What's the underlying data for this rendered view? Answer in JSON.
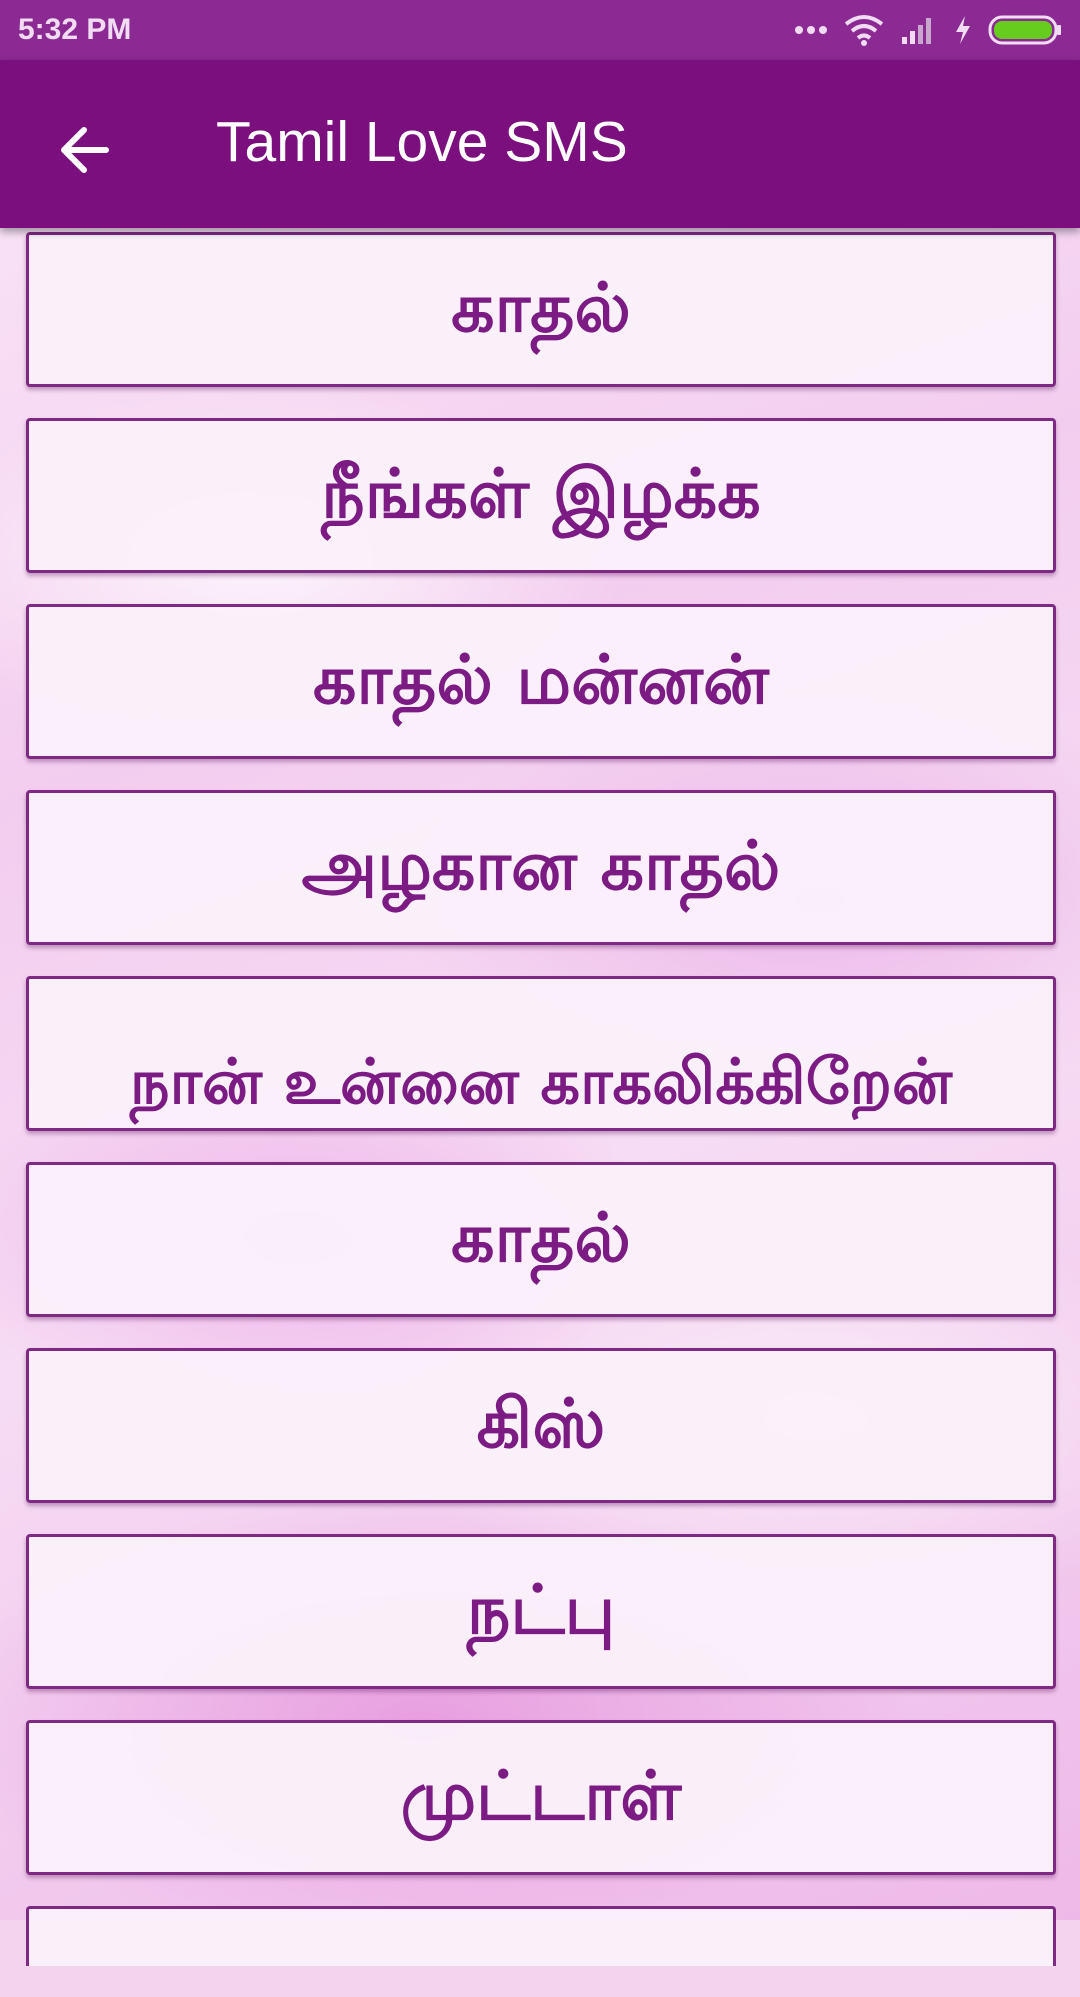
{
  "status_bar": {
    "time": "5:32 PM",
    "icons": [
      "more-dots-icon",
      "wifi-icon",
      "cell-signal-icon",
      "charging-icon",
      "battery-icon"
    ]
  },
  "app_bar": {
    "back_icon": "arrow-back-icon",
    "title": "Tamil Love SMS"
  },
  "categories": [
    "காதல்",
    "நீங்கள் இழக்க",
    "காதல் மன்னன்",
    "அழகான காதல்",
    "நான் உன்னை காகலிக்கிறேன்",
    "காதல்",
    "கிஸ்",
    "நட்பு",
    "முட்டாள்"
  ],
  "colors": {
    "status_bar": "#8a2a92",
    "app_bar": "#7b0f7e",
    "item_border": "#7e2a84",
    "item_text": "#7b1b83",
    "battery_fill": "#66cc1e"
  }
}
